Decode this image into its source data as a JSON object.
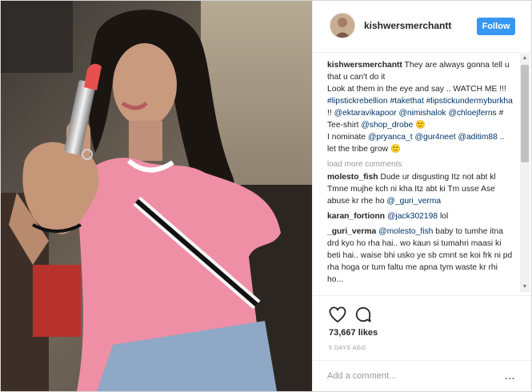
{
  "post": {
    "username": "kishwersmerchantt",
    "follow_label": "Follow",
    "caption": {
      "username": "kishwersmerchantt",
      "line1": "They are always gonna tell u that u can't do it",
      "line2": "Look at them in the eye and say .. WATCH ME !!! ",
      "tag1": "#lipstickrebellion",
      "space1": " ",
      "tag2": "#takethat",
      "space2": " ",
      "tag3": "#lipstickundermyburkha",
      "txt3": " !! ",
      "tag4": "@ektaravikapoor",
      "space3": " ",
      "tag5": "@nimishalok",
      "space4": " ",
      "tag6": "@chloejferns",
      "txt4": " # Tee-shirt ",
      "tag7": "@shop_drobe",
      "txt5": " 🙂",
      "line3": "I nominate ",
      "tag8": "@pryanca_t",
      "space5": " ",
      "tag9": "@gur4neet",
      "space6": " ",
      "tag10": "@aditim88",
      "txt6": " .. let the tribe grow 🙂"
    },
    "load_more": "load more comments",
    "comments": [
      {
        "username": "molesto_fish",
        "text": "Dude ur disgusting Itz not abt kl Tmne mujhe kch ni kha Itz abt ki Tm usse Ase abuse kr rhe ho ",
        "mention": "@_guri_verma",
        "after": ""
      },
      {
        "username": "karan_fortionn",
        "text": "",
        "mention": "@jack302198",
        "after": " lol"
      },
      {
        "username": "_guri_verma",
        "text": "",
        "mention": "@molesto_fish",
        "after": " baby to tumhe itna drd kyo ho rha hai.. wo kaun si tumahri maasi ki beti hai.. waise bhi usko ye sb cmnt se koi frk ni pd rha hoga or tum faltu me apna tym waste kr rhi ho..."
      }
    ],
    "likes": "73,667 likes",
    "time_ago": "5 DAYS AGO",
    "add_comment_placeholder": "Add a comment...",
    "more_icon": "…"
  },
  "icons": {
    "heart": "heart-icon",
    "comment": "comment-bubble-icon",
    "more": "more-options-icon",
    "scroll_up": "▲",
    "scroll_down": "▼"
  },
  "colors": {
    "follow_button": "#3897f0",
    "link": "#003569",
    "shirt": "#ef8fa6",
    "lipstick": "#e8504f"
  }
}
